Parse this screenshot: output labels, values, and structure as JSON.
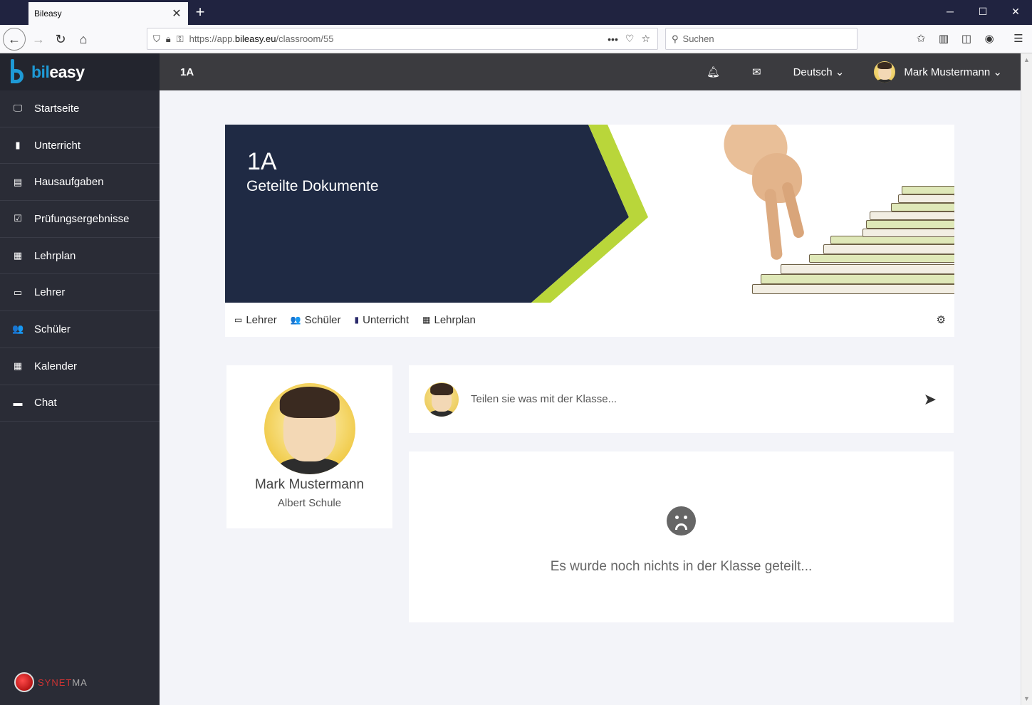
{
  "browser": {
    "tab_title": "Bileasy",
    "tab_close": "✕",
    "new_tab": "+",
    "url_prefix": "https://app.",
    "url_domain": "bileasy.eu",
    "url_path": "/classroom/55",
    "search_placeholder": "Suchen",
    "more_icon": "•••"
  },
  "brand": {
    "logo_prefix": "bil",
    "logo_suffix": "easy"
  },
  "sidebar": {
    "items": [
      {
        "label": "Startseite",
        "icon": "monitor-icon",
        "glyph": "🖵"
      },
      {
        "label": "Unterricht",
        "icon": "book-icon",
        "glyph": "▮"
      },
      {
        "label": "Hausaufgaben",
        "icon": "clipboard-icon",
        "glyph": "▤"
      },
      {
        "label": "Prüfungsergebnisse",
        "icon": "checklist-icon",
        "glyph": "☑"
      },
      {
        "label": "Lehrplan",
        "icon": "calendar-icon",
        "glyph": "▦"
      },
      {
        "label": "Lehrer",
        "icon": "chalkboard-teacher-icon",
        "glyph": "▭"
      },
      {
        "label": "Schüler",
        "icon": "users-icon",
        "glyph": "👥"
      },
      {
        "label": "Kalender",
        "icon": "calendar-grid-icon",
        "glyph": "▦"
      },
      {
        "label": "Chat",
        "icon": "chat-icon",
        "glyph": "▬"
      }
    ],
    "footer_logo_red": "SYNET",
    "footer_logo_grey": "MA"
  },
  "header": {
    "title": "1A",
    "language": "Deutsch",
    "user_name": "Mark Mustermann",
    "caret": "⌄"
  },
  "banner": {
    "title": "1A",
    "subtitle": "Geteilte Dokumente"
  },
  "subnav": {
    "items": [
      {
        "label": "Lehrer",
        "icon": "chalkboard-teacher-icon",
        "glyph": "▭"
      },
      {
        "label": "Schüler",
        "icon": "users-icon",
        "glyph": "👥"
      },
      {
        "label": "Unterricht",
        "icon": "book-icon",
        "glyph": "▮"
      },
      {
        "label": "Lehrplan",
        "icon": "calendar-icon",
        "glyph": "▦"
      }
    ],
    "settings_glyph": "⚙"
  },
  "profile": {
    "name": "Mark Mustermann",
    "school": "Albert Schule"
  },
  "share": {
    "placeholder": "Teilen sie was mit der Klasse...",
    "send_glyph": "➤"
  },
  "feed": {
    "empty_text": "Es wurde noch nichts in der Klasse geteilt..."
  },
  "colors": {
    "sidebar_bg": "#2a2c36",
    "header_bg": "#3b3b3f",
    "banner_navy": "#1f2a44",
    "banner_green": "#b9d63a",
    "brand_blue": "#1e9ad6",
    "page_bg": "#f3f4f9"
  }
}
